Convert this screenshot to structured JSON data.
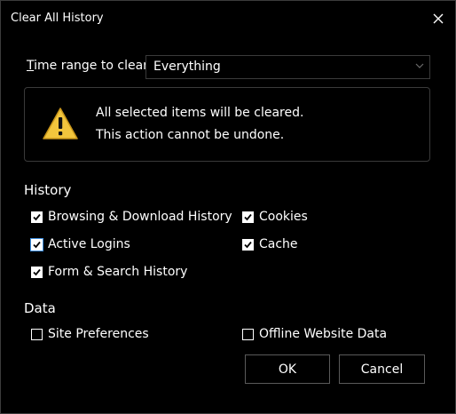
{
  "dialog": {
    "title": "Clear All History",
    "close_icon": "close-icon"
  },
  "time_range": {
    "label_mnemonic": "T",
    "label_rest": "ime range to clear:",
    "selected": "Everything"
  },
  "warning": {
    "icon": "warning-icon",
    "line1": "All selected items will be cleared.",
    "line2": "This action cannot be undone."
  },
  "history": {
    "heading": "History",
    "items": [
      {
        "label": "Browsing & Download History",
        "checked": true
      },
      {
        "label": "Cookies",
        "checked": true
      },
      {
        "label": "Active Logins",
        "checked": true
      },
      {
        "label": "Cache",
        "checked": true
      },
      {
        "label": "Form & Search History",
        "checked": true
      }
    ]
  },
  "data_section": {
    "heading": "Data",
    "items": [
      {
        "label": "Site Preferences",
        "checked": false
      },
      {
        "label": "Offline Website Data",
        "checked": false
      }
    ]
  },
  "buttons": {
    "ok": "OK",
    "cancel": "Cancel"
  },
  "colors": {
    "background": "#000000",
    "text": "#ffffff",
    "border": "#3a3a3a",
    "focus": "#3d8ee0",
    "warning_fill": "#f2c53d"
  }
}
